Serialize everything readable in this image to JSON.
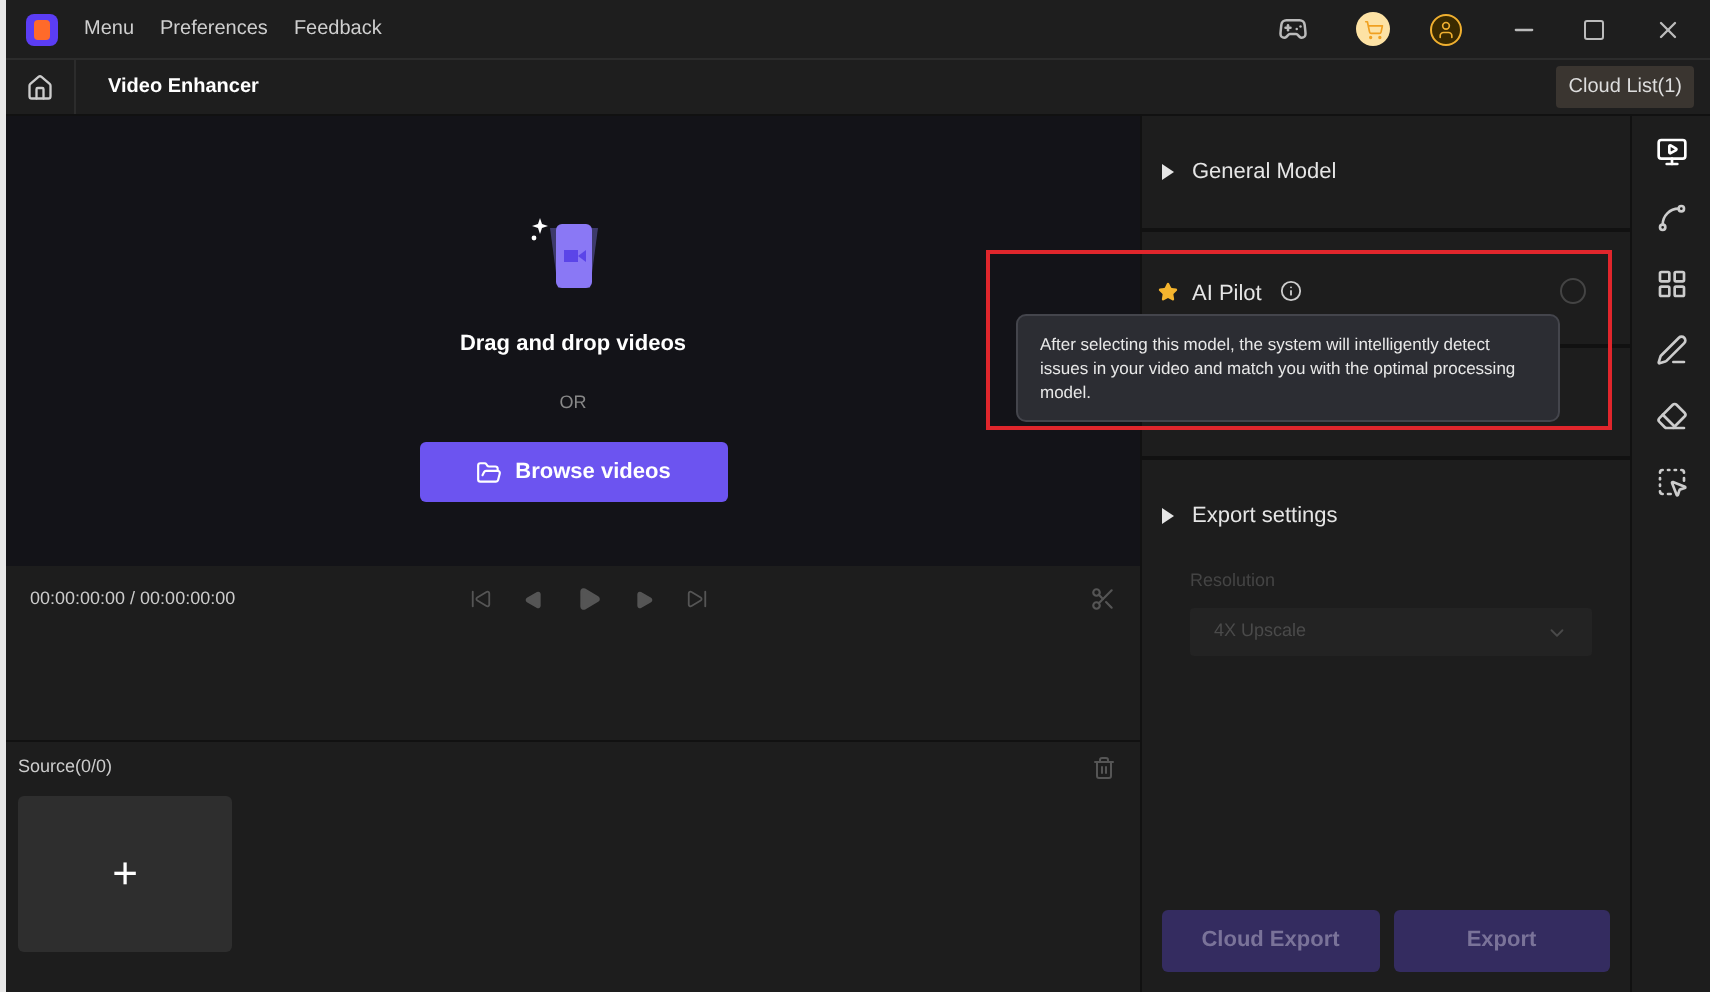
{
  "menu": [
    "Menu",
    "Preferences",
    "Feedback"
  ],
  "toolbar": {
    "title": "Video Enhancer",
    "cloud_list": "Cloud List(1)"
  },
  "dropzone": {
    "heading": "Drag and drop videos",
    "or": "OR",
    "button": "Browse videos"
  },
  "player": {
    "time": "00:00:00:00 / 00:00:00:00"
  },
  "source": {
    "title": "Source(0/0)",
    "add": "+"
  },
  "models": [
    {
      "kind": "section",
      "title": "General Model"
    },
    {
      "kind": "radio",
      "title": "AI Pilot",
      "selected": false
    }
  ],
  "tooltip": "After selecting this model, the system will intelligently detect issues in your video and match you with the optimal processing model.",
  "export": {
    "title": "Export settings",
    "label": "Resolution",
    "value": "4X Upscale",
    "disabled": true
  },
  "buttons": [
    {
      "label": "Cloud Export",
      "disabled": true
    },
    {
      "label": "Export",
      "disabled": true
    }
  ]
}
